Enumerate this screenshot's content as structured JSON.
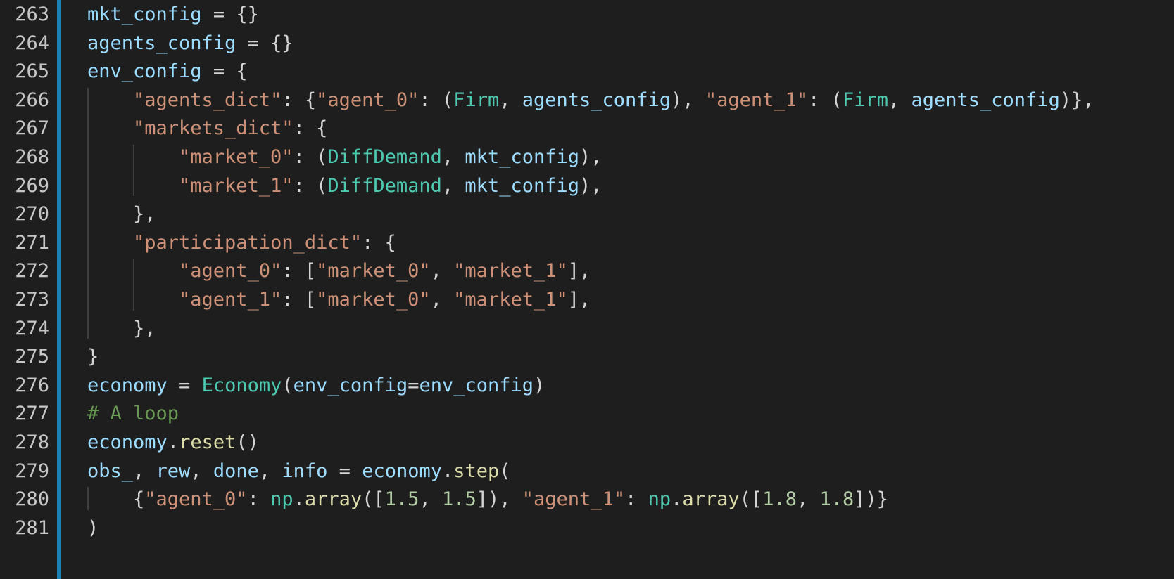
{
  "editor": {
    "lines": [
      {
        "number": "263",
        "indent": 0,
        "tokens": [
          {
            "t": "mkt_config",
            "k": "var"
          },
          {
            "t": " = {}",
            "k": "pun"
          }
        ]
      },
      {
        "number": "264",
        "indent": 0,
        "tokens": [
          {
            "t": "agents_config",
            "k": "var"
          },
          {
            "t": " = {}",
            "k": "pun"
          }
        ]
      },
      {
        "number": "265",
        "indent": 0,
        "tokens": [
          {
            "t": "env_config",
            "k": "var"
          },
          {
            "t": " = {",
            "k": "pun"
          }
        ]
      },
      {
        "number": "266",
        "indent": 1,
        "tokens": [
          {
            "t": "\"agents_dict\"",
            "k": "str"
          },
          {
            "t": ": {",
            "k": "pun"
          },
          {
            "t": "\"agent_0\"",
            "k": "str"
          },
          {
            "t": ": (",
            "k": "pun"
          },
          {
            "t": "Firm",
            "k": "cls"
          },
          {
            "t": ", ",
            "k": "pun"
          },
          {
            "t": "agents_config",
            "k": "var"
          },
          {
            "t": "), ",
            "k": "pun"
          },
          {
            "t": "\"agent_1\"",
            "k": "str"
          },
          {
            "t": ": (",
            "k": "pun"
          },
          {
            "t": "Firm",
            "k": "cls"
          },
          {
            "t": ", ",
            "k": "pun"
          },
          {
            "t": "agents_config",
            "k": "var"
          },
          {
            "t": ")},",
            "k": "pun"
          }
        ]
      },
      {
        "number": "267",
        "indent": 1,
        "tokens": [
          {
            "t": "\"markets_dict\"",
            "k": "str"
          },
          {
            "t": ": {",
            "k": "pun"
          }
        ]
      },
      {
        "number": "268",
        "indent": 2,
        "tokens": [
          {
            "t": "\"market_0\"",
            "k": "str"
          },
          {
            "t": ": (",
            "k": "pun"
          },
          {
            "t": "DiffDemand",
            "k": "cls"
          },
          {
            "t": ", ",
            "k": "pun"
          },
          {
            "t": "mkt_config",
            "k": "var"
          },
          {
            "t": "),",
            "k": "pun"
          }
        ]
      },
      {
        "number": "269",
        "indent": 2,
        "tokens": [
          {
            "t": "\"market_1\"",
            "k": "str"
          },
          {
            "t": ": (",
            "k": "pun"
          },
          {
            "t": "DiffDemand",
            "k": "cls"
          },
          {
            "t": ", ",
            "k": "pun"
          },
          {
            "t": "mkt_config",
            "k": "var"
          },
          {
            "t": "),",
            "k": "pun"
          }
        ]
      },
      {
        "number": "270",
        "indent": 1,
        "tokens": [
          {
            "t": "},",
            "k": "pun"
          }
        ]
      },
      {
        "number": "271",
        "indent": 1,
        "tokens": [
          {
            "t": "\"participation_dict\"",
            "k": "str"
          },
          {
            "t": ": {",
            "k": "pun"
          }
        ]
      },
      {
        "number": "272",
        "indent": 2,
        "tokens": [
          {
            "t": "\"agent_0\"",
            "k": "str"
          },
          {
            "t": ": [",
            "k": "pun"
          },
          {
            "t": "\"market_0\"",
            "k": "str"
          },
          {
            "t": ", ",
            "k": "pun"
          },
          {
            "t": "\"market_1\"",
            "k": "str"
          },
          {
            "t": "],",
            "k": "pun"
          }
        ]
      },
      {
        "number": "273",
        "indent": 2,
        "tokens": [
          {
            "t": "\"agent_1\"",
            "k": "str"
          },
          {
            "t": ": [",
            "k": "pun"
          },
          {
            "t": "\"market_0\"",
            "k": "str"
          },
          {
            "t": ", ",
            "k": "pun"
          },
          {
            "t": "\"market_1\"",
            "k": "str"
          },
          {
            "t": "],",
            "k": "pun"
          }
        ]
      },
      {
        "number": "274",
        "indent": 1,
        "tokens": [
          {
            "t": "},",
            "k": "pun"
          }
        ]
      },
      {
        "number": "275",
        "indent": 0,
        "tokens": [
          {
            "t": "}",
            "k": "pun"
          }
        ]
      },
      {
        "number": "276",
        "indent": 0,
        "tokens": [
          {
            "t": "economy",
            "k": "var"
          },
          {
            "t": " = ",
            "k": "pun"
          },
          {
            "t": "Economy",
            "k": "cls"
          },
          {
            "t": "(",
            "k": "pun"
          },
          {
            "t": "env_config",
            "k": "var"
          },
          {
            "t": "=",
            "k": "pun"
          },
          {
            "t": "env_config",
            "k": "var"
          },
          {
            "t": ")",
            "k": "pun"
          }
        ]
      },
      {
        "number": "277",
        "indent": 0,
        "tokens": [
          {
            "t": "# A loop",
            "k": "com"
          }
        ]
      },
      {
        "number": "278",
        "indent": 0,
        "tokens": [
          {
            "t": "economy",
            "k": "var"
          },
          {
            "t": ".",
            "k": "pun"
          },
          {
            "t": "reset",
            "k": "fn"
          },
          {
            "t": "()",
            "k": "pun"
          }
        ]
      },
      {
        "number": "279",
        "indent": 0,
        "tokens": [
          {
            "t": "obs_",
            "k": "var"
          },
          {
            "t": ", ",
            "k": "pun"
          },
          {
            "t": "rew",
            "k": "var"
          },
          {
            "t": ", ",
            "k": "pun"
          },
          {
            "t": "done",
            "k": "var"
          },
          {
            "t": ", ",
            "k": "pun"
          },
          {
            "t": "info",
            "k": "var"
          },
          {
            "t": " = ",
            "k": "pun"
          },
          {
            "t": "economy",
            "k": "var"
          },
          {
            "t": ".",
            "k": "pun"
          },
          {
            "t": "step",
            "k": "fn"
          },
          {
            "t": "(",
            "k": "pun"
          }
        ]
      },
      {
        "number": "280",
        "indent": 1,
        "tokens": [
          {
            "t": "{",
            "k": "pun"
          },
          {
            "t": "\"agent_0\"",
            "k": "str"
          },
          {
            "t": ": ",
            "k": "pun"
          },
          {
            "t": "np",
            "k": "cls"
          },
          {
            "t": ".",
            "k": "pun"
          },
          {
            "t": "array",
            "k": "fn"
          },
          {
            "t": "([",
            "k": "pun"
          },
          {
            "t": "1.5",
            "k": "num"
          },
          {
            "t": ", ",
            "k": "pun"
          },
          {
            "t": "1.5",
            "k": "num"
          },
          {
            "t": "]), ",
            "k": "pun"
          },
          {
            "t": "\"agent_1\"",
            "k": "str"
          },
          {
            "t": ": ",
            "k": "pun"
          },
          {
            "t": "np",
            "k": "cls"
          },
          {
            "t": ".",
            "k": "pun"
          },
          {
            "t": "array",
            "k": "fn"
          },
          {
            "t": "([",
            "k": "pun"
          },
          {
            "t": "1.8",
            "k": "num"
          },
          {
            "t": ", ",
            "k": "pun"
          },
          {
            "t": "1.8",
            "k": "num"
          },
          {
            "t": "])}",
            "k": "pun"
          }
        ]
      },
      {
        "number": "281",
        "indent": 0,
        "tokens": [
          {
            "t": ")",
            "k": "pun"
          }
        ]
      }
    ],
    "colors": {
      "background": "#1e1e1e",
      "gutter_marker": "#1b82b8",
      "line_number": "#c6c6c6",
      "variable": "#9cdcfe",
      "string": "#ce9178",
      "class": "#4ec9b0",
      "function": "#dcdcaa",
      "number": "#b5cea8",
      "comment": "#6a9955",
      "punctuation": "#d4d4d4"
    }
  }
}
